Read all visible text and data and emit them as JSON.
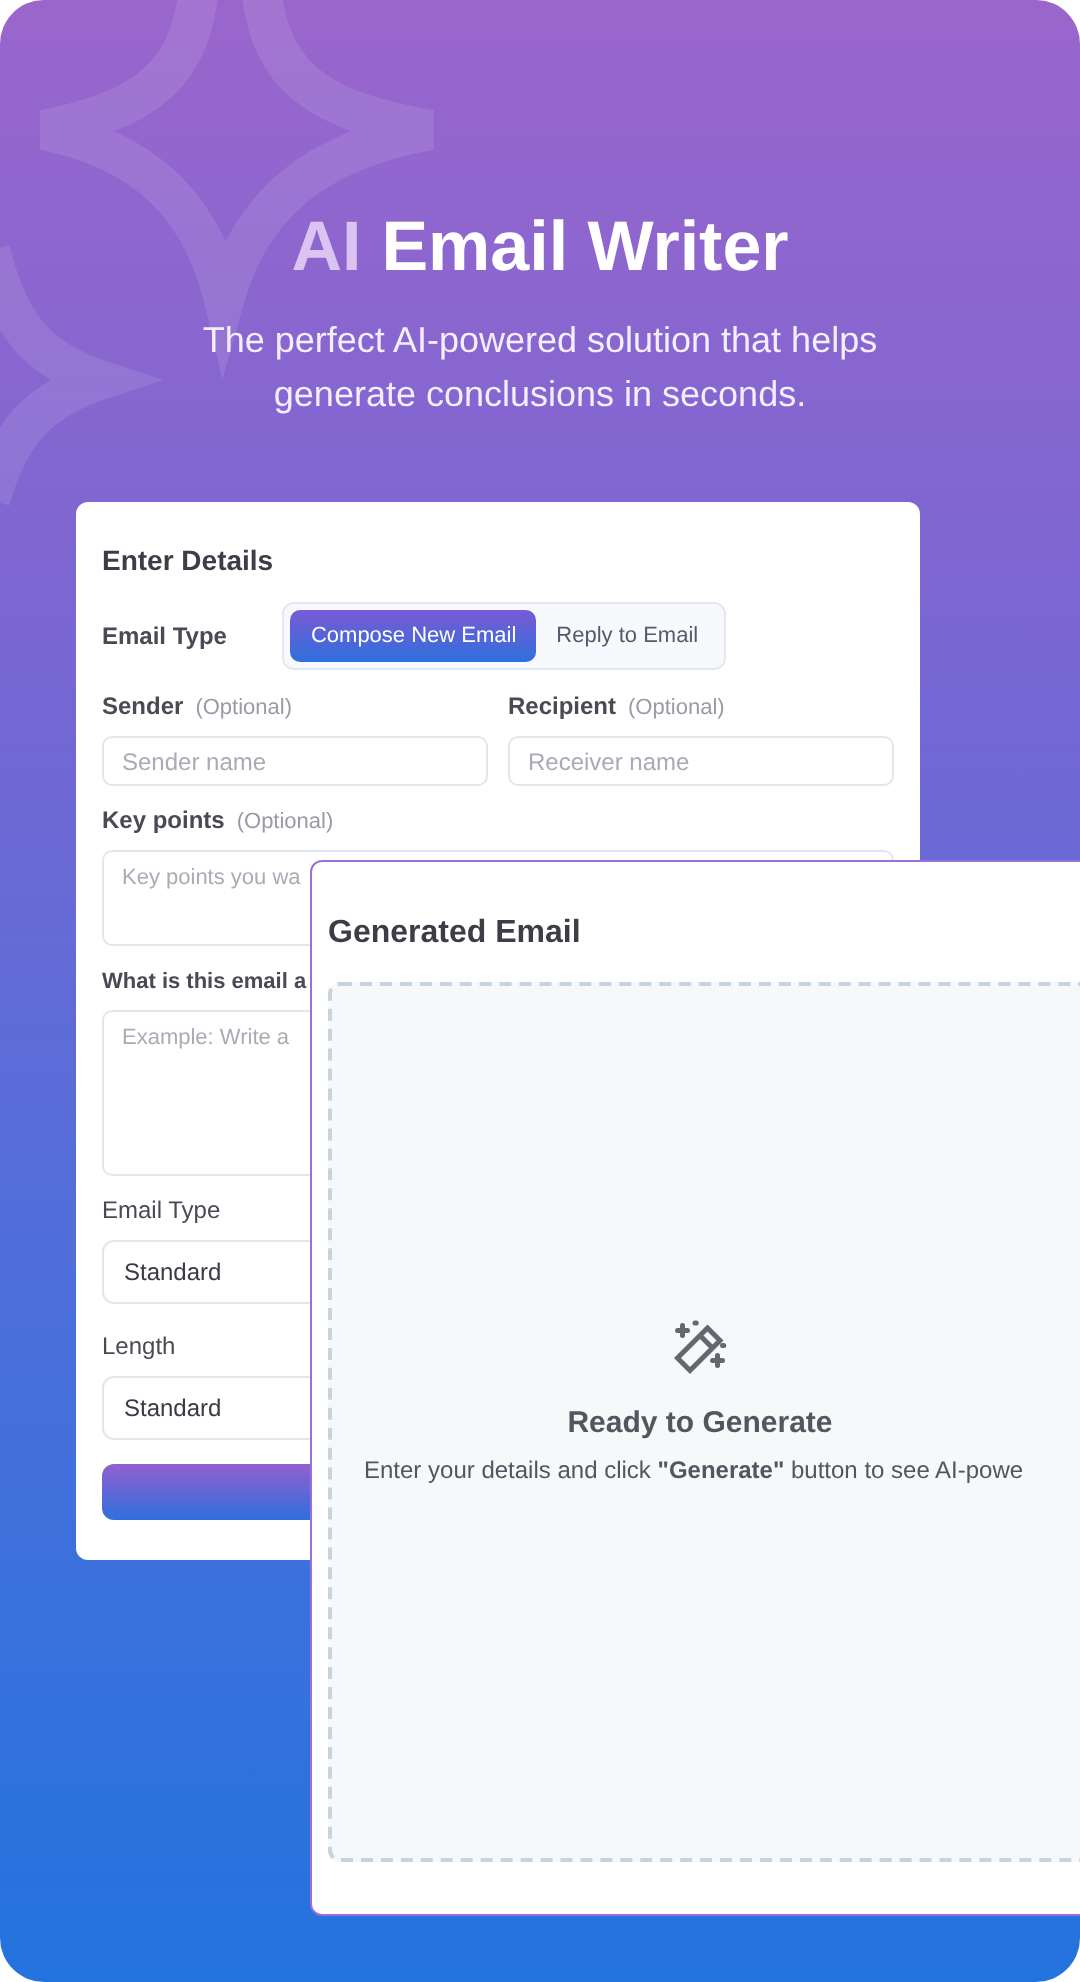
{
  "hero": {
    "title_prefix": "AI",
    "title": "Email Writer",
    "subtitle": "The perfect AI-powered solution that helps generate conclusions in seconds."
  },
  "details_form": {
    "heading": "Enter Details",
    "email_type_label": "Email Type",
    "email_type_options": [
      {
        "label": "Compose New Email",
        "selected": true
      },
      {
        "label": "Reply to Email",
        "selected": false
      }
    ],
    "sender": {
      "label": "Sender",
      "hint": "(Optional)",
      "placeholder": "Sender name"
    },
    "recipient": {
      "label": "Recipient",
      "hint": "(Optional)",
      "placeholder": "Receiver name"
    },
    "key_points": {
      "label": "Key points",
      "hint": "(Optional)",
      "placeholder": "Key points you wa"
    },
    "topic": {
      "label": "What is this email a",
      "placeholder": "Example: Write a"
    },
    "selects": [
      {
        "label": "Email Type",
        "value": "Standard"
      },
      {
        "label": "Length",
        "value": "Standard"
      }
    ]
  },
  "output": {
    "heading": "Generated Email",
    "empty_title": "Ready to Generate",
    "empty_text": "Enter your details and click **\"Generate\"** button to see AI-powe"
  }
}
